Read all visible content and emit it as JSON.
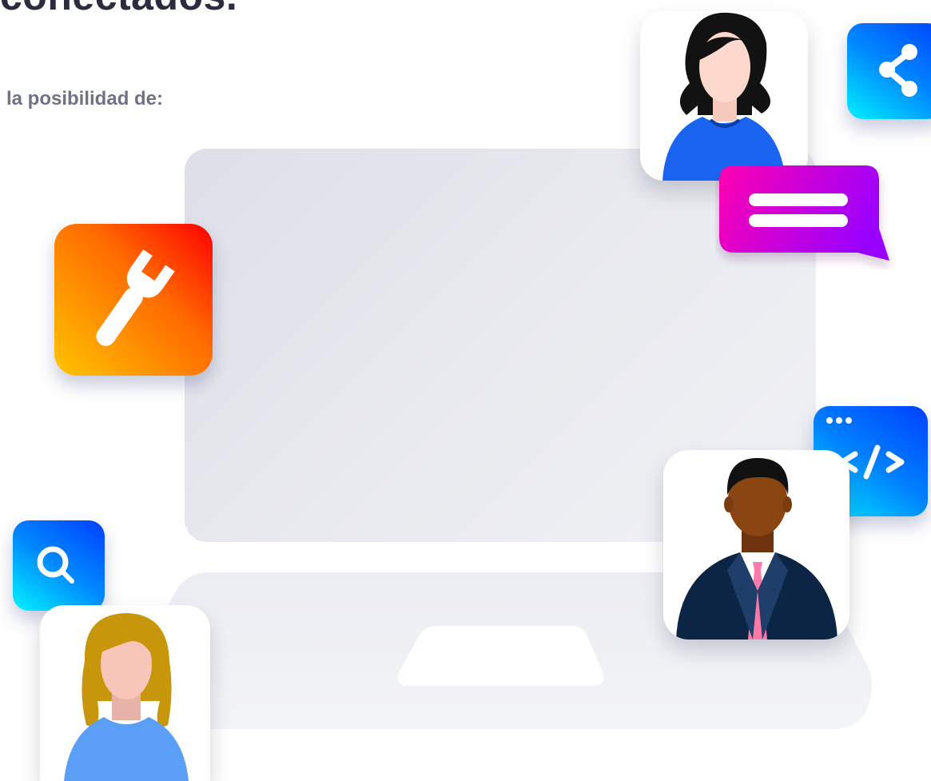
{
  "header": {
    "title": "conectados.",
    "subtitle": "la posibilidad de:"
  },
  "icons": {
    "tools": "wrench-icon",
    "share": "share-icon",
    "chat": "chat-icon",
    "code": "code-icon",
    "search": "search-icon"
  },
  "colors": {
    "tools_gradient": [
      "#ffc400",
      "#ff0000"
    ],
    "blue_gradient": [
      "#00f0ff",
      "#0052ff"
    ],
    "chat_gradient": [
      "#ff00b4",
      "#9800ff"
    ]
  }
}
